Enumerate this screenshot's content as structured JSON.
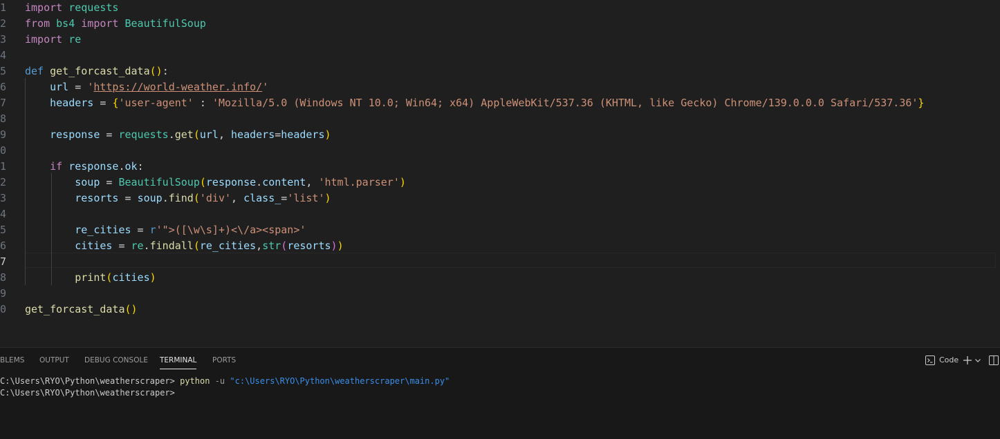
{
  "editor": {
    "line_numbers": [
      "1",
      "2",
      "3",
      "4",
      "5",
      "6",
      "7",
      "8",
      "9",
      "0",
      "1",
      "2",
      "3",
      "4",
      "5",
      "6",
      "7",
      "8",
      "9",
      "0"
    ],
    "line1": {
      "kw_import": "import",
      "mod": "requests"
    },
    "line2": {
      "kw_from": "from",
      "mod": "bs4",
      "kw_import": "import",
      "cls": "BeautifulSoup"
    },
    "line3": {
      "kw_import": "import",
      "mod": "re"
    },
    "line5": {
      "kw_def": "def",
      "fn": "get_forcast_data",
      "paren_open": "(",
      "paren_close": ")",
      "colon": ":"
    },
    "line6": {
      "indent": "    ",
      "var": "url",
      "op": " = ",
      "str_q1": "'",
      "str_url": "https://world-weather.info/",
      "str_q2": "'"
    },
    "line7": {
      "indent": "    ",
      "var": "headers",
      "op": " = ",
      "brace_open": "{",
      "str_key": "'user-agent'",
      "colon": " : ",
      "str_value": "'Mozilla/5.0 (Windows NT 10.0; Win64; x64) AppleWebKit/537.36 (KHTML, like Gecko) Chrome/139.0.0.0 Safari/537.36'",
      "brace_close": "}"
    },
    "line9": {
      "indent": "    ",
      "var": "response",
      "op": " = ",
      "mod": "requests",
      "dot": ".",
      "fn": "get",
      "paren_open": "(",
      "arg1": "url",
      "comma": ", ",
      "kwarg": "headers",
      "eq": "=",
      "arg2": "headers",
      "paren_close": ")"
    },
    "line11": {
      "indent": "    ",
      "kw_if": "if",
      "sp": " ",
      "var": "response",
      "dot": ".",
      "attr": "ok",
      "colon": ":"
    },
    "line12": {
      "indent": "        ",
      "var": "soup",
      "op": " = ",
      "cls": "BeautifulSoup",
      "paren_open": "(",
      "obj": "response",
      "dot": ".",
      "attr": "content",
      "comma": ", ",
      "str": "'html.parser'",
      "paren_close": ")"
    },
    "line13": {
      "indent": "        ",
      "var": "resorts",
      "op": " = ",
      "obj": "soup",
      "dot": ".",
      "fn": "find",
      "paren_open": "(",
      "str1": "'div'",
      "comma": ", ",
      "kwarg": "class_",
      "eq": "=",
      "str2": "'list'",
      "paren_close": ")"
    },
    "line15": {
      "indent": "        ",
      "var": "re_cities",
      "op": " = ",
      "prefix": "r",
      "str": "'\">([\\w\\s]+)<\\/a><span>'"
    },
    "line16": {
      "indent": "        ",
      "var": "cities",
      "op": " = ",
      "mod": "re",
      "dot": ".",
      "fn": "findall",
      "paren_open": "(",
      "arg1": "re_cities",
      "comma": ",",
      "fn2": "str",
      "paren2_open": "(",
      "arg2": "resorts",
      "paren2_close": ")",
      "paren_close": ")"
    },
    "line18": {
      "indent": "        ",
      "fn": "print",
      "paren_open": "(",
      "arg": "cities",
      "paren_close": ")"
    },
    "line20": {
      "fn": "get_forcast_data",
      "paren_open": "(",
      "paren_close": ")"
    }
  },
  "panel": {
    "tabs": [
      "BLEMS",
      "OUTPUT",
      "DEBUG CONSOLE",
      "TERMINAL",
      "PORTS"
    ],
    "active_tab": "TERMINAL",
    "toolbar": {
      "shell_label": "Code",
      "plus": "+",
      "chevron": "⌄"
    }
  },
  "terminal": {
    "line1": {
      "prompt": "C:\\Users\\RYO\\Python\\weatherscraper>",
      "cmd": "python",
      "flag": "-u",
      "path": "\"c:\\Users\\RYO\\Python\\weatherscraper\\main.py\""
    },
    "line2": {
      "prompt": "C:\\Users\\RYO\\Python\\weatherscraper>"
    }
  },
  "colors": {
    "background": "#1f1f1f",
    "panel": "#181818",
    "keyword": "#c586c0",
    "module": "#4ec9b0",
    "def": "#569cd6",
    "function": "#dcdcaa",
    "variable": "#9cdcfe",
    "string": "#ce9178",
    "bracket1": "#ffd700",
    "bracket2": "#da70d6",
    "bracket3": "#179fff"
  },
  "icons": [
    "terminal-icon",
    "plus-icon",
    "chevron-down-icon",
    "split-panel-icon"
  ]
}
